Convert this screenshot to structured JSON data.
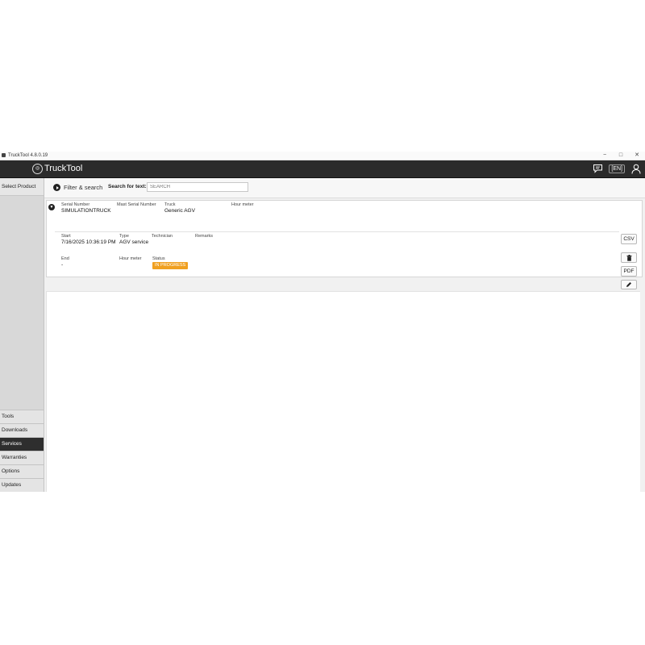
{
  "window": {
    "title": "TruckTool 4.8.0.19",
    "controls": [
      "−",
      "□",
      "✕"
    ]
  },
  "header": {
    "app_name": "TruckTool",
    "logo_icon": "truck-logo-icon",
    "language": "[EN]",
    "icons": [
      "chat-icon",
      "user-icon"
    ]
  },
  "sidebar": {
    "select_product": "Select Product",
    "items": [
      {
        "label": "Tools",
        "active": false
      },
      {
        "label": "Downloads",
        "active": false
      },
      {
        "label": "Services",
        "active": true
      },
      {
        "label": "Warranties",
        "active": false
      },
      {
        "label": "Options",
        "active": false
      },
      {
        "label": "Updates",
        "active": false
      }
    ]
  },
  "filter": {
    "label": "Filter & search",
    "search_label": "Search for text:",
    "search_placeholder": "SEARCH",
    "search_value": ""
  },
  "record": {
    "serial_number_label": "Serial Number",
    "serial_number": "SIMULATIONTRUCK",
    "mast_serial_label": "Mast Serial Number",
    "mast_serial": "",
    "truck_label": "Truck",
    "truck": "Generic AGV",
    "hour_meter_label": "Hour meter",
    "hour_meter": "",
    "start_label": "Start",
    "start": "7/16/2025 10:36:19 PM",
    "type_label": "Type",
    "type": "AGV service",
    "technician_label": "Technician",
    "technician": "",
    "remarks_label": "Remarks",
    "remarks": "",
    "end_label": "End",
    "end": "-",
    "hour_meter2_label": "Hour meter",
    "hour_meter2": "",
    "status_label": "Status",
    "status": "IN PROGRESS",
    "status_color": "#f0a020"
  },
  "actions": {
    "csv": "CSV",
    "delete_icon": "trash-icon",
    "pdf": "PDF",
    "edit_icon": "pencil-icon"
  }
}
